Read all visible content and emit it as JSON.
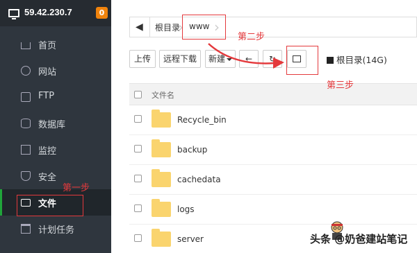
{
  "sidebar": {
    "server_ip": "59.42.230.7",
    "badge": "0",
    "items": [
      {
        "label": "首页",
        "icon": "home-icon"
      },
      {
        "label": "网站",
        "icon": "globe-icon"
      },
      {
        "label": "FTP",
        "icon": "ftp-icon"
      },
      {
        "label": "数据库",
        "icon": "database-icon"
      },
      {
        "label": "监控",
        "icon": "monitor-icon"
      },
      {
        "label": "安全",
        "icon": "shield-icon"
      },
      {
        "label": "文件",
        "icon": "folder-icon",
        "active": true
      },
      {
        "label": "计划任务",
        "icon": "calendar-icon"
      }
    ]
  },
  "breadcrumb": {
    "back_icon": "back-arrow-icon",
    "root": "根目录",
    "current": "www"
  },
  "toolbar": {
    "upload": "上传",
    "remote_download": "远程下载",
    "new": "新建",
    "disk": "根目录(14G)"
  },
  "table": {
    "header_name": "文件名",
    "rows": [
      "Recycle_bin",
      "backup",
      "cachedata",
      "logs",
      "server"
    ]
  },
  "annotations": {
    "step1": "第一步",
    "step2": "第二步",
    "step3": "第三步",
    "color": "#e4393c"
  },
  "watermark": "头条 @奶爸建站笔记"
}
